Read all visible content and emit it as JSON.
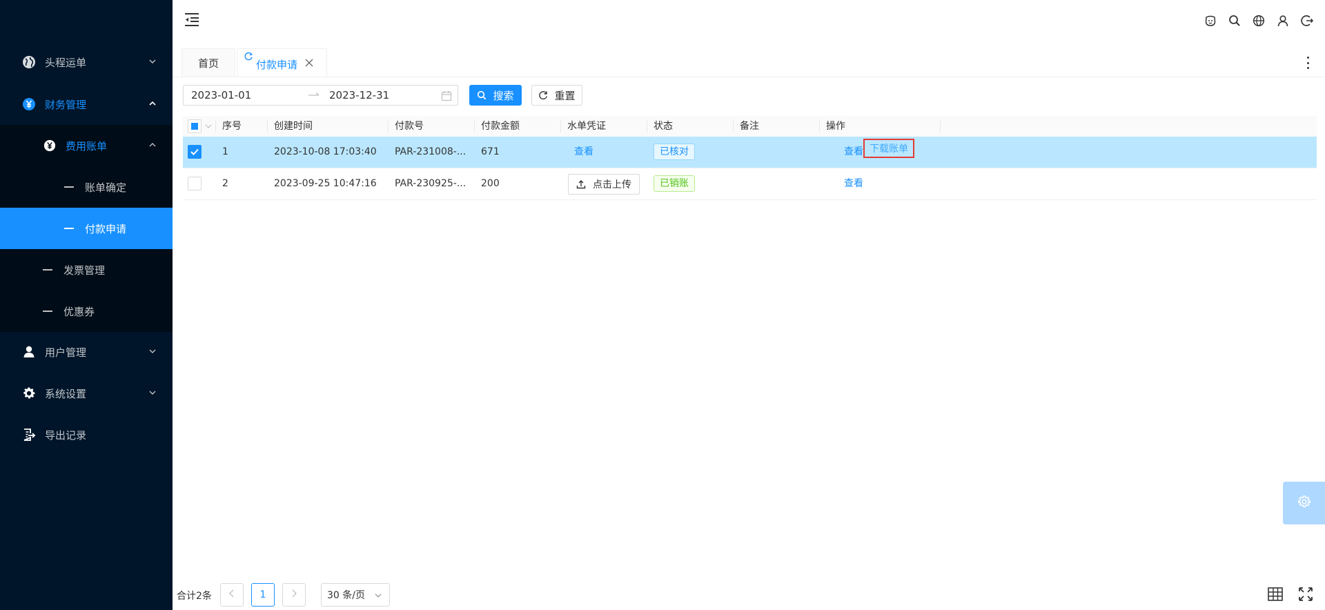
{
  "sidebar": {
    "items": [
      {
        "label": "头程运单",
        "icon": "globe-icon"
      },
      {
        "label": "财务管理",
        "icon": "yen-circle-icon"
      },
      {
        "label": "费用账单",
        "icon": "yen-circle-icon"
      },
      {
        "label": "账单确定"
      },
      {
        "label": "付款申请"
      },
      {
        "label": "发票管理"
      },
      {
        "label": "优惠券"
      },
      {
        "label": "用户管理",
        "icon": "user-icon"
      },
      {
        "label": "系统设置",
        "icon": "gear-icon"
      },
      {
        "label": "导出记录",
        "icon": "export-doc-icon"
      }
    ]
  },
  "header": {
    "icons": [
      "robot-icon",
      "search-icon",
      "globe-lang-icon",
      "user-icon",
      "logout-icon"
    ]
  },
  "tabs": {
    "home": "首页",
    "current": "付款申请"
  },
  "filter": {
    "start_date": "2023-01-01",
    "end_date": "2023-12-31",
    "search_label": "搜索",
    "reset_label": "重置"
  },
  "table": {
    "columns": [
      "序号",
      "创建时间",
      "付款号",
      "付款金额",
      "水单凭证",
      "状态",
      "备注",
      "操作"
    ],
    "rows": [
      {
        "index": "1",
        "created": "2023-10-08 17:03:40",
        "payment_no": "PAR-231008-...",
        "amount": "671",
        "voucher": "查看",
        "status": "已核对",
        "remark": "",
        "action_view": "查看",
        "action_download": "下载账单"
      },
      {
        "index": "2",
        "created": "2023-09-25 10:47:16",
        "payment_no": "PAR-230925-...",
        "amount": "200",
        "voucher": "点击上传",
        "status": "已销账",
        "remark": "",
        "action_view": "查看"
      }
    ]
  },
  "pagination": {
    "total": "合计2条",
    "current_page": "1",
    "page_size": "30 条/页"
  },
  "colors": {
    "sidebar_bg": "#001529",
    "primary": "#1890ff",
    "selected_row": "#bae7ff",
    "highlight_box": "#e53935"
  }
}
